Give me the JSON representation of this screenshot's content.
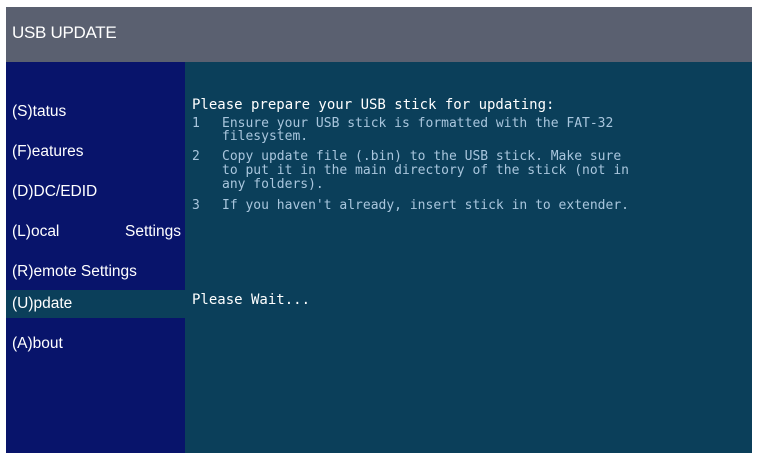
{
  "window": {
    "title": "USB UPDATE"
  },
  "sidebar": {
    "items": [
      {
        "label": "(S)tatus",
        "active": false
      },
      {
        "label": "(F)eatures",
        "active": false
      },
      {
        "label": "(D)DC/EDID",
        "active": false
      },
      {
        "label_left": "(L)ocal",
        "label_right": "Settings",
        "active": false
      },
      {
        "label": "(R)emote Settings",
        "active": false
      },
      {
        "label": "(U)pdate",
        "active": true
      },
      {
        "label": "(A)bout",
        "active": false
      }
    ]
  },
  "content": {
    "heading": "Please prepare your USB stick for updating:",
    "steps": [
      {
        "number": "1",
        "lines": [
          "Ensure your USB stick is formatted with the FAT-32",
          "filesystem."
        ]
      },
      {
        "number": "2",
        "lines": [
          "Copy update file (.bin) to the USB stick. Make sure",
          "to put it in the main directory of the stick (not in",
          "any folders)."
        ]
      },
      {
        "number": "3",
        "lines": [
          "If you haven't already, insert stick in to extender."
        ]
      }
    ],
    "status": "Please Wait..."
  },
  "colors": {
    "title_bar": "#5a6070",
    "sidebar_bg": "#08146b",
    "content_bg": "#0b3f5a",
    "instruction_text": "#a9c6dd",
    "primary_text": "#ffffff"
  }
}
